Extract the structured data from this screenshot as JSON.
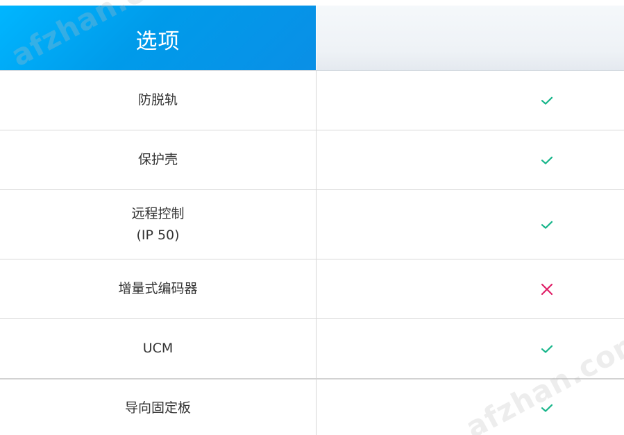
{
  "header": {
    "title": "选项",
    "title_bg_start": "#00b6ff",
    "title_bg_end": "#0a8fe6"
  },
  "rows": [
    {
      "label": "防脱轨",
      "status": "check"
    },
    {
      "label": "保护壳",
      "status": "check"
    },
    {
      "label": "远程控制\n(IP 50)",
      "status": "check"
    },
    {
      "label": "增量式编码器",
      "status": "cross"
    },
    {
      "label": "UCM",
      "status": "check"
    },
    {
      "label": "导向固定板",
      "status": "check"
    }
  ],
  "icons": {
    "check": "check-icon",
    "cross": "cross-icon"
  },
  "colors": {
    "check": "#17b58a",
    "cross": "#e01f67",
    "text": "#333333"
  },
  "watermark": {
    "text": "afzhan.com"
  }
}
